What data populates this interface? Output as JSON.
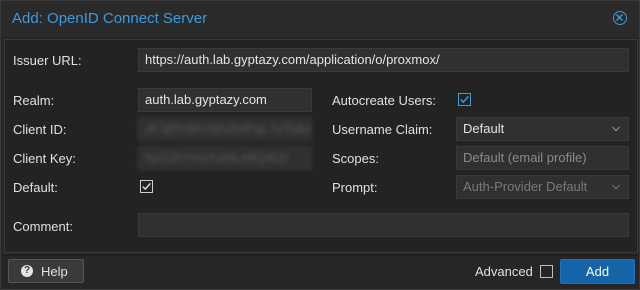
{
  "dialog": {
    "title": "Add: OpenID Connect Server"
  },
  "form": {
    "issuer_url": {
      "label": "Issuer URL:",
      "value": "https://auth.lab.gyptazy.com/application/o/proxmox/"
    },
    "realm": {
      "label": "Realm:",
      "value": "auth.lab.gyptazy.com"
    },
    "client_id": {
      "label": "Client ID:",
      "value": "dF3jRn9KcWx2mPqL7vTsBz"
    },
    "client_key": {
      "label": "Client Key:",
      "value": "hpD2kYmvXaNLb8Q4tZr"
    },
    "default": {
      "label": "Default:",
      "checked": true
    },
    "autocreate_users": {
      "label": "Autocreate Users:",
      "checked": true
    },
    "username_claim": {
      "label": "Username Claim:",
      "value": "Default"
    },
    "scopes": {
      "label": "Scopes:",
      "placeholder": "Default (email profile)"
    },
    "prompt": {
      "label": "Prompt:",
      "value": "Auth-Provider Default"
    },
    "comment": {
      "label": "Comment:",
      "value": ""
    }
  },
  "footer": {
    "help_label": "Help",
    "advanced_label": "Advanced",
    "advanced_checked": false,
    "add_label": "Add"
  },
  "colors": {
    "accent": "#3b9be0",
    "primary_button": "#1565a8",
    "dialog_bg": "#262626",
    "field_bg": "#303030"
  },
  "icons": {
    "close": "close-circle-icon",
    "help": "question-circle-icon",
    "dropdown": "chevron-down-icon",
    "check": "check-icon"
  }
}
